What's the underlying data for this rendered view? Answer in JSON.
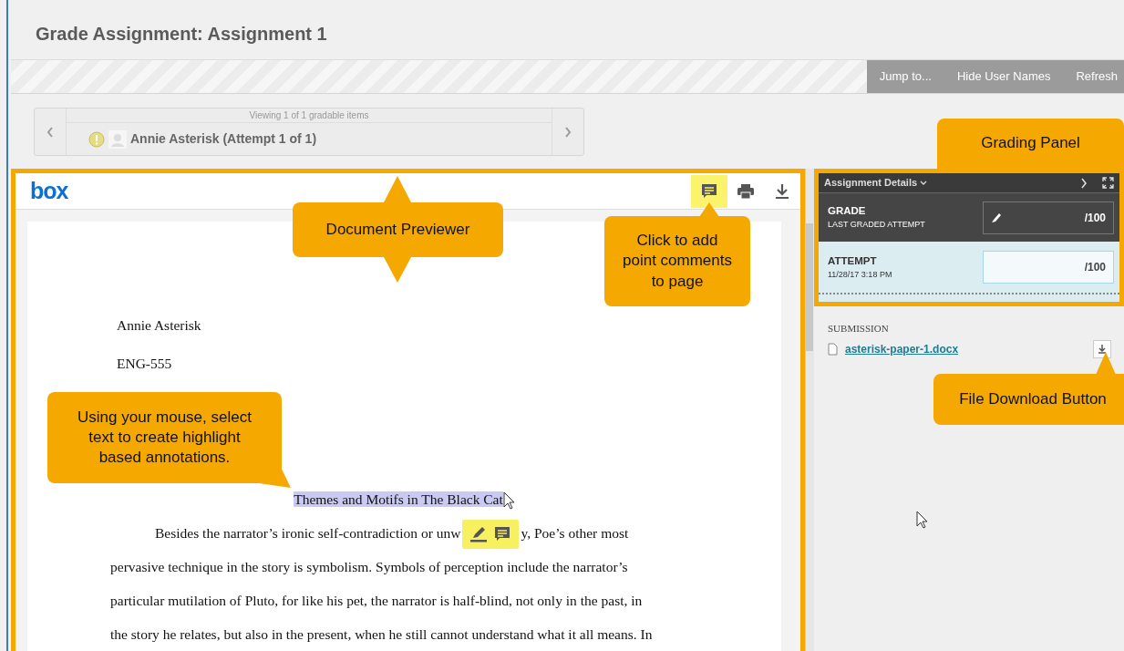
{
  "page_title": "Grade Assignment: Assignment 1",
  "toolbar": {
    "buttons": [
      "Jump to...",
      "Hide User Names",
      "Refresh"
    ]
  },
  "navigator": {
    "caption": "Viewing 1 of 1 gradable items",
    "student": "Annie Asterisk (Attempt 1 of 1)"
  },
  "previewer": {
    "logo": "box",
    "tools": [
      {
        "kind": "comment",
        "selected": true
      },
      {
        "kind": "print",
        "selected": false
      },
      {
        "kind": "download",
        "selected": false
      }
    ],
    "lines": [
      {
        "kind": "heading",
        "parts": [
          "Annie Asterisk"
        ]
      },
      {
        "kind": "heading",
        "parts": [
          "ENG-555"
        ]
      },
      {
        "kind": "title",
        "parts": [
          "Themes and Motifs in The Black Cat"
        ],
        "highlighted": true
      },
      {
        "kind": "first",
        "parts": [
          "Besides the narrator’s ironic self-contradiction or unw",
          "y, Poe’s other most"
        ]
      },
      {
        "kind": "body",
        "parts": [
          "pervasive technique in the story is symbolism. Symbols of perception include the narrator’s"
        ]
      },
      {
        "kind": "body",
        "parts": [
          "particular mutilation of Pluto, for like his pet, the narrator is half-blind, not only in the past, in"
        ]
      },
      {
        "kind": "body",
        "parts": [
          "the story he relates, but also in the present, when he still cannot understand what it all means. In"
        ]
      }
    ]
  },
  "grading_panel": {
    "header": "Assignment Details",
    "rows": [
      {
        "kind": "grade",
        "label": "GRADE",
        "sublabel": "LAST GRADED ATTEMPT",
        "value": "/100"
      },
      {
        "kind": "attempt",
        "label": "ATTEMPT",
        "sublabel": "11/28/17 3:18 PM",
        "value": "/100"
      }
    ]
  },
  "submission": {
    "heading": "SUBMISSION",
    "file": "asterisk-paper-1.docx"
  },
  "callouts": [
    {
      "kind": "grading-panel",
      "text": "Grading Panel"
    },
    {
      "kind": "previewer",
      "text": "Document Previewer"
    },
    {
      "kind": "point-comment",
      "text": "Click to add point comments to page"
    },
    {
      "kind": "download",
      "text": "File Download Button"
    },
    {
      "kind": "highlight",
      "text": "Using your mouse, select text to create highlight based annotations."
    }
  ]
}
